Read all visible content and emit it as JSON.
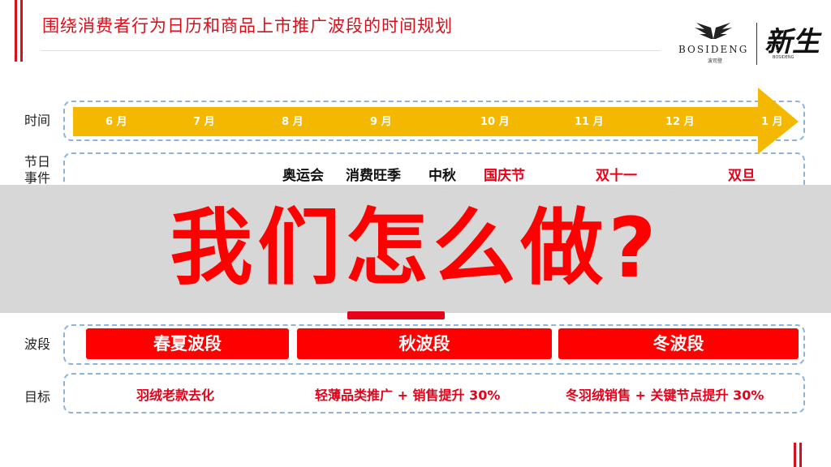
{
  "header": {
    "title": "围绕消费者行为日历和商品上市推广波段的时间规划",
    "accent_color": "#d8101c"
  },
  "logo": {
    "brand": "BOSIDENG",
    "brand_sub": "波司登",
    "script": "新生",
    "script_sub": "BOSIDENG"
  },
  "rows": {
    "time": "时间",
    "events": "节日\n事件",
    "wave": "波段",
    "goal": "目标"
  },
  "timeline": {
    "arrow_color": "#f5b800",
    "months": [
      "6 月",
      "7 月",
      "8 月",
      "9 月",
      "10 月",
      "11 月",
      "12 月",
      "1 月"
    ]
  },
  "events": [
    {
      "label": "奥运会",
      "color": "black"
    },
    {
      "label": "消费旺季",
      "color": "black"
    },
    {
      "label": "中秋",
      "color": "black"
    },
    {
      "label": "国庆节",
      "color": "red"
    },
    {
      "label": "双十一",
      "color": "red"
    },
    {
      "label": "双旦",
      "color": "red"
    }
  ],
  "overlay": {
    "text": "我们怎么做?"
  },
  "waves": [
    {
      "label": "春夏波段"
    },
    {
      "label": "秋波段"
    },
    {
      "label": "冬波段"
    }
  ],
  "goals": [
    {
      "label": "羽绒老款去化"
    },
    {
      "label": "轻薄品类推广 + 销售提升 30%"
    },
    {
      "label": "冬羽绒销售 + 关键节点提升 30%"
    }
  ]
}
